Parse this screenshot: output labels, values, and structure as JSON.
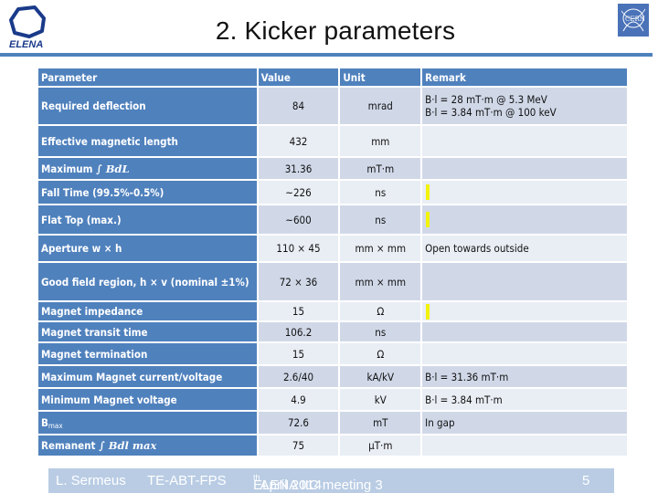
{
  "header": {
    "title": "2. Kicker parameters",
    "left_logo_text": "ELENA",
    "right_logo_text": "CERN"
  },
  "table": {
    "columns": [
      "Parameter",
      "Value",
      "Unit",
      "Remark"
    ],
    "rows": [
      {
        "parameter": "Required  deflection",
        "value": "84",
        "unit": "mrad",
        "remark": [
          "B·l = 28 mT·m @ 5.3 MeV",
          "B·l = 3.84 mT·m @ 100 keV"
        ]
      },
      {
        "parameter": "Effective magnetic length",
        "value": "432",
        "unit": "mm",
        "remark": []
      },
      {
        "parameter": "Maximum ∫ BdL",
        "parameter_prefix": "Maximum",
        "parameter_math": "∫ BdL",
        "value": "31.36",
        "unit": "mT·m",
        "remark": []
      },
      {
        "parameter": "Fall Time (99.5%-0.5%)",
        "value": "~226",
        "unit": "ns",
        "remark": [],
        "highlight_mark": true
      },
      {
        "parameter": "Flat Top (max.)",
        "value": "~600",
        "unit": "ns",
        "remark": [],
        "highlight_mark": true
      },
      {
        "parameter": "Aperture w × h",
        "value": "110 × 45",
        "unit": "mm × mm",
        "remark": [
          "Open towards outside"
        ]
      },
      {
        "parameter": "Good field region, h × v (nominal ±1%)",
        "value": "72 × 36",
        "unit": "mm × mm",
        "remark": []
      },
      {
        "parameter": "Magnet impedance",
        "value": "15",
        "unit": "Ω",
        "remark": [],
        "highlight_mark": true
      },
      {
        "parameter": "Magnet transit time",
        "value": "106.2",
        "unit": "ns",
        "remark": []
      },
      {
        "parameter": "Magnet termination",
        "value": "15",
        "unit": "Ω",
        "remark": []
      },
      {
        "parameter": "Maximum Magnet current/voltage",
        "value": "2.6/40",
        "unit": "kA/kV",
        "remark": [
          "B·l = 31.36 mT·m"
        ]
      },
      {
        "parameter": "Minimum Magnet voltage",
        "value": "4.9",
        "unit": "kV",
        "remark": [
          "B·l = 3.84 mT·m"
        ]
      },
      {
        "parameter": "Bmax",
        "parameter_prefix": "B",
        "parameter_sub": "max",
        "value": "72.6",
        "unit": "mT",
        "remark": [
          "In gap"
        ]
      },
      {
        "parameter": "Remanent ∫ Bdl max",
        "parameter_prefix": "Remanent",
        "parameter_math": "∫ Bdl max",
        "value": "75",
        "unit": "µT·m",
        "remark": []
      }
    ]
  },
  "footer": {
    "author": "L. Sermeus",
    "group": "TE-ABT-FPS",
    "event_prefix": "ELENA IIC meeting 3",
    "event_sup": "th",
    "event_suffix": " April 2014",
    "page_number": "5"
  },
  "colors": {
    "accent": "#4f81bd",
    "row_odd": "#d0d8e8",
    "row_even": "#e9edf4",
    "footer": "#b9cce4",
    "highlight": "#f2f20a"
  }
}
